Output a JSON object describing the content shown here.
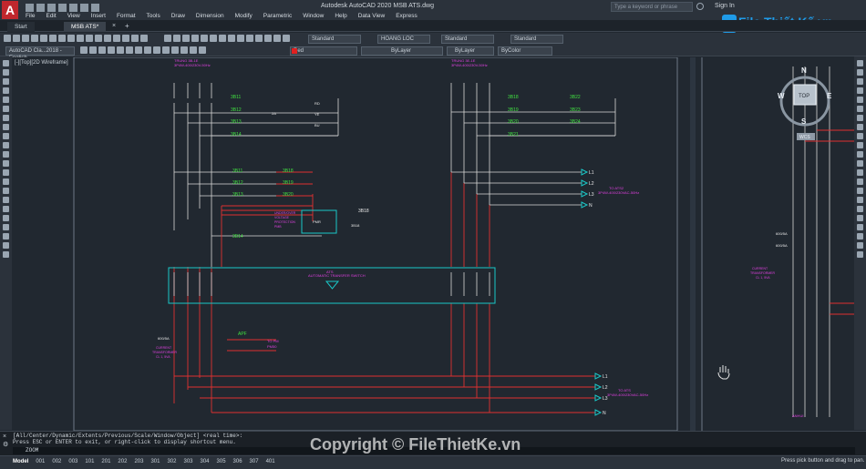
{
  "app": {
    "title": "Autodesk AutoCAD 2020   MSB ATS.dwg",
    "search_placeholder": "Type a keyword or phrase",
    "signin": "Sign In",
    "accent": "#c0272d"
  },
  "menu": [
    "File",
    "Edit",
    "View",
    "Insert",
    "Format",
    "Tools",
    "Draw",
    "Dimension",
    "Modify",
    "Parametric",
    "Window",
    "Help",
    "Data View",
    "Express"
  ],
  "tabs": [
    {
      "label": "Start"
    },
    {
      "label": "MSB ATS*"
    }
  ],
  "toolbar": {
    "text_style": "Standard",
    "dim_style": "HOANG LOC",
    "table_style": "Standard",
    "ml_style": "Standard",
    "workspace": "AutoCAD Cla...2018 - English",
    "color": "Red",
    "linetype": "ByLayer",
    "lineweight": "ByLayer",
    "plotstyle": "ByColor"
  },
  "viewport_label": "[-][Top][2D Wireframe]",
  "viewcube": {
    "n": "N",
    "s": "S",
    "e": "E",
    "w": "W",
    "face": "TOP",
    "wcs": "WCS"
  },
  "drawing": {
    "top_left_labels": [
      "TRUNG 3B-1E",
      "3P4W-400/230V-50Hz"
    ],
    "top_right_labels": [
      "TRUNG 3E-1E",
      "3P4W-400/230V-50Hz"
    ],
    "circuits_left": [
      "3B11",
      "3B12",
      "3B13",
      "3B14"
    ],
    "circuits_right": [
      "3B18",
      "3B19",
      "3B20",
      "3B21"
    ],
    "circuits_right2": [
      "3B22",
      "3B23",
      "3B24"
    ],
    "lamp_labels": [
      "RD",
      "YE",
      "BU"
    ],
    "breaker_rating": "2A",
    "relay_labels": [
      "UNDER/OVER",
      "VOLTAGE",
      "PROTECTION",
      "PMB"
    ],
    "relay_codes": [
      "3B18",
      "3B19",
      "3B20",
      "3B18",
      "3B18"
    ],
    "relay_title": "PMR",
    "ats_label": [
      "ATS",
      "AUTOMATIC TRANSFER SWITCH"
    ],
    "phases": [
      "L1",
      "L2",
      "L3",
      "N"
    ],
    "bus_label_top": [
      "TO ATS2",
      "3P4W-400/230VAC-50Hz"
    ],
    "bus_label_bottom": [
      "TO ATS",
      "3P4W-400/230VAC-50Hz"
    ],
    "ct_labels": [
      "CT",
      "600/5A",
      "CURRENT",
      "TRANSFORMER",
      "CL 1, 5VA"
    ],
    "apf_label": "APF",
    "meter_label": [
      "TO PM",
      "PM50"
    ],
    "right_panel": [
      "600/5A",
      "600/5A",
      "CURRENT",
      "TRANSFORMER",
      "CL 1, 5VA",
      "ANHUI"
    ]
  },
  "command": {
    "line1": "[All/Center/Dynamic/Extents/Previous/Scale/Window/Object] <real time>:",
    "line2": "Press ESC or ENTER to exit, or right-click to display shortcut menu.",
    "input": "ZOOM"
  },
  "layouts": [
    "Model",
    "001",
    "002",
    "003",
    "101",
    "201",
    "202",
    "203",
    "301",
    "302",
    "303",
    "304",
    "305",
    "306",
    "307",
    "401"
  ],
  "status_message": "Press pick button and drag to pan.",
  "watermark": "Copyright © FileThietKe.vn",
  "brand": "File Thiết Kế.vn"
}
